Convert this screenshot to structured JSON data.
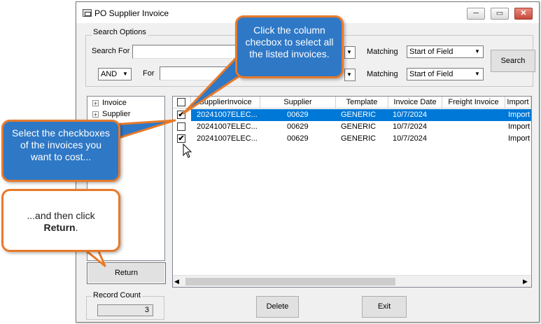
{
  "window": {
    "title": "PO Supplier Invoice",
    "minimize": "─",
    "maximize": "▭",
    "close": "✕"
  },
  "search_options": {
    "group_label": "Search Options",
    "search_for_label": "Search For",
    "search_for_value": "",
    "operator": "AND",
    "for_label": "For",
    "for_value": "",
    "matching_label": "Matching",
    "matching_1": "Start of Field",
    "matching_2": "Start of Field",
    "search_button": "Search"
  },
  "tree": {
    "items": [
      "Invoice",
      "Supplier"
    ]
  },
  "grid": {
    "columns": [
      "SupplierInvoice",
      "Supplier",
      "Template",
      "Invoice Date",
      "Freight Invoice",
      "Import"
    ],
    "rows": [
      {
        "checked": true,
        "selected": true,
        "invoice": "20241007ELEC...",
        "supplier": "00629",
        "template": "GENERIC",
        "date": "10/7/2024",
        "freight": "",
        "import": "Import"
      },
      {
        "checked": false,
        "selected": false,
        "invoice": "20241007ELEC...",
        "supplier": "00629",
        "template": "GENERIC",
        "date": "10/7/2024",
        "freight": "",
        "import": "Import"
      },
      {
        "checked": true,
        "selected": false,
        "invoice": "20241007ELEC...",
        "supplier": "00629",
        "template": "GENERIC",
        "date": "10/7/2024",
        "freight": "",
        "import": "Import"
      }
    ],
    "check_mark": "✔"
  },
  "buttons": {
    "return": "Return",
    "delete": "Delete",
    "exit": "Exit"
  },
  "record_count": {
    "label": "Record Count",
    "value": "3"
  },
  "callouts": {
    "column_checkbox": "Click the column checbox to select all the listed invoices.",
    "select_checkboxes": "Select the checkboxes of the invoices you want to cost...",
    "return_pre": "...and then click",
    "return_bold": "Return",
    "return_post": "."
  },
  "colors": {
    "callout_blue": "#2e78c6",
    "callout_border": "#e87a2a",
    "selection": "#0078d7"
  }
}
